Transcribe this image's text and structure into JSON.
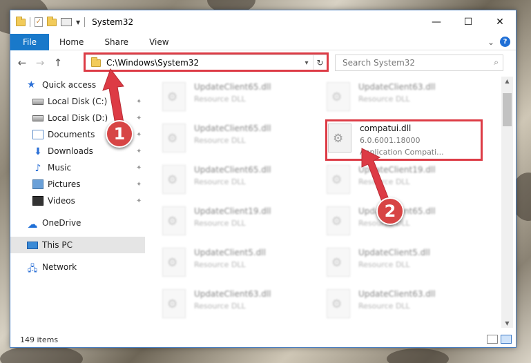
{
  "window": {
    "title": "System32",
    "controls": {
      "minimize": "—",
      "maximize": "☐",
      "close": "✕"
    }
  },
  "ribbon": {
    "tabs": [
      "File",
      "Home",
      "Share",
      "View"
    ],
    "expand_glyph": "⌄",
    "help_glyph": "?"
  },
  "address": {
    "path": "C:\\Windows\\System32",
    "dropdown_glyph": "▾",
    "refresh_glyph": "↻"
  },
  "search": {
    "placeholder": "Search System32",
    "icon_glyph": "⌕"
  },
  "nav": {
    "back": "←",
    "forward": "→",
    "up": "↑"
  },
  "sidebar": {
    "items": [
      {
        "label": "Quick access",
        "icon": "star-icon"
      },
      {
        "label": "Local Disk (C:)",
        "icon": "disk-icon",
        "pinned": true
      },
      {
        "label": "Local Disk (D:)",
        "icon": "disk-icon",
        "pinned": true
      },
      {
        "label": "Documents",
        "icon": "documents-icon",
        "pinned": true
      },
      {
        "label": "Downloads",
        "icon": "downloads-icon",
        "pinned": true
      },
      {
        "label": "Music",
        "icon": "music-icon",
        "pinned": true
      },
      {
        "label": "Pictures",
        "icon": "pictures-icon",
        "pinned": true
      },
      {
        "label": "Videos",
        "icon": "videos-icon",
        "pinned": true
      },
      {
        "label": "OneDrive",
        "icon": "onedrive-icon"
      },
      {
        "label": "This PC",
        "icon": "pc-icon",
        "selected": true
      },
      {
        "label": "Network",
        "icon": "network-icon"
      }
    ],
    "pin_glyph": "📌"
  },
  "files": {
    "left_column": [
      {
        "name": "UpdateClient65.dll",
        "type": "Resource DLL"
      },
      {
        "name": "UpdateClient65.dll",
        "type": "Resource DLL"
      },
      {
        "name": "UpdateClient65.dll",
        "type": "Resource DLL"
      },
      {
        "name": "UpdateClient19.dll",
        "type": "Resource DLL"
      },
      {
        "name": "UpdateClient5.dll",
        "type": "Resource DLL"
      },
      {
        "name": "UpdateClient63.dll",
        "type": "Resource DLL"
      }
    ],
    "right_column": [
      {
        "name": "UpdateClient63.dll",
        "type": "Resource DLL"
      },
      {
        "name": "UpdateClient19.dll",
        "type": "Resource DLL"
      },
      {
        "name": "UpdateClient65.dll",
        "type": "Resource DLL"
      },
      {
        "name": "UpdateClient5.dll",
        "type": "Resource DLL"
      },
      {
        "name": "UpdateClient63.dll",
        "type": "Resource DLL"
      }
    ],
    "highlighted": {
      "name": "compatui.dll",
      "version": "6.0.6001.18000",
      "description": "Application Compati..."
    }
  },
  "status": {
    "item_count": "149 items"
  },
  "annotations": {
    "badge1": "1",
    "badge2": "2",
    "color": "#dd3b45"
  }
}
